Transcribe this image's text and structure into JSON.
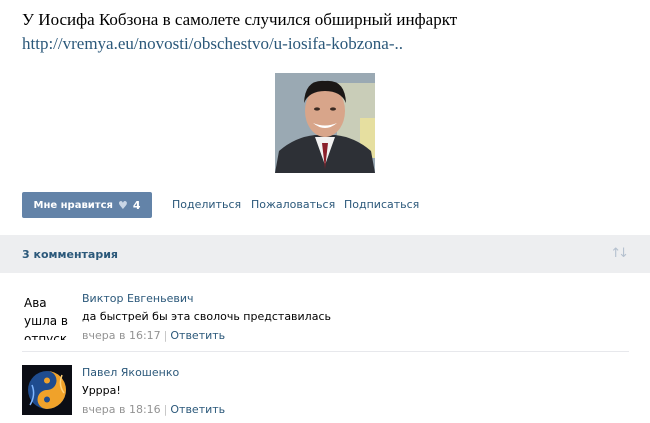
{
  "post": {
    "title": "У Иосифа Кобзона в самолете случился обширный инфаркт",
    "link": "http://vremya.eu/novosti/obschestvo/u-iosifa-kobzona-.."
  },
  "actions": {
    "like_label": "Мне нравится",
    "like_count": "4",
    "share": "Поделиться",
    "report": "Пожаловаться",
    "subscribe": "Подписаться"
  },
  "comments_header": {
    "count_label": "3 комментария"
  },
  "comments": [
    {
      "avatar_text": "Ава ушла в отпуск",
      "author": "Виктор Евгеньевич",
      "text": "да быстрей бы эта сволочь представилась",
      "time": "вчера в 16:17",
      "reply": "Ответить"
    },
    {
      "author": "Павел Якошенко",
      "text": "Уррра!",
      "time": "вчера в 18:16",
      "reply": "Ответить"
    }
  ],
  "colors": {
    "link": "#2b587a",
    "like_button": "#6383a8",
    "bar": "#edeef0"
  }
}
